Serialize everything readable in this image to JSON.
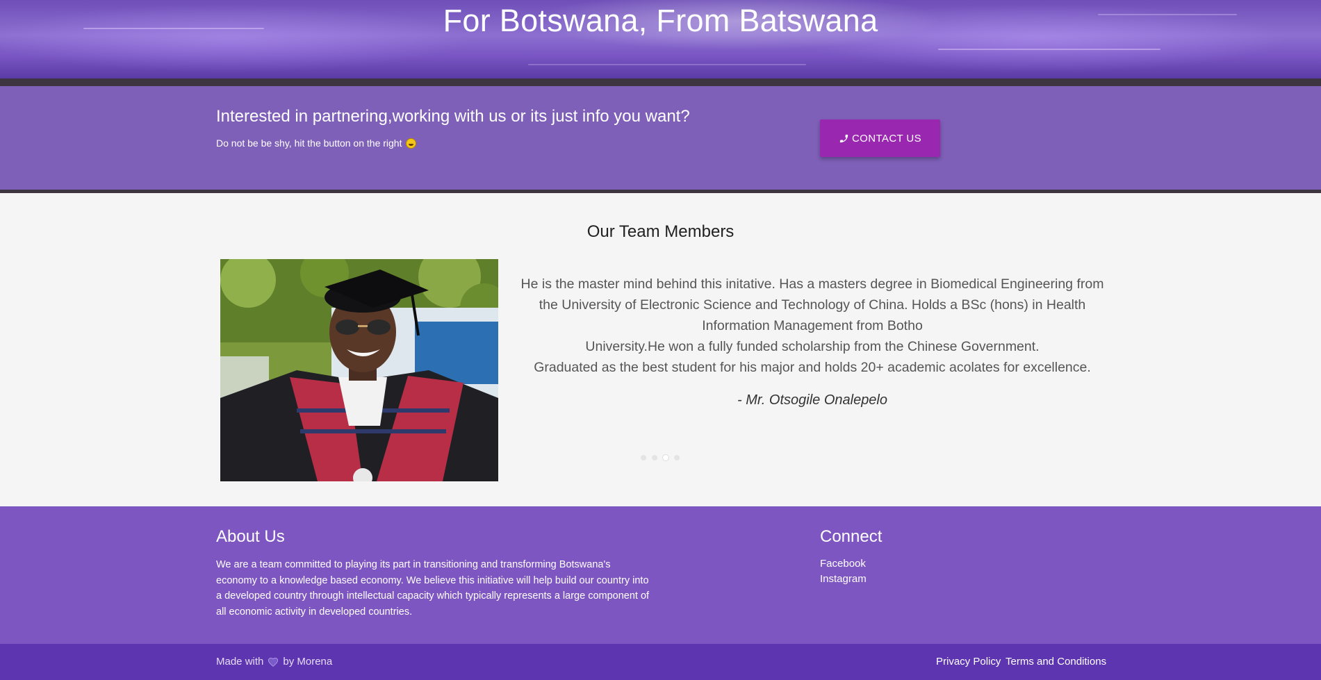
{
  "banner": {
    "title": "For Botswana, From Batswana"
  },
  "cta": {
    "heading": "Interested in partnering,working with us or its just info you want?",
    "subtext": "Do not be be shy, hit the button on the right",
    "button_label": "CONTACT US",
    "button_icon": "phone-icon",
    "button_color": "#9a27b0"
  },
  "team": {
    "title": "Our Team Members",
    "bio_lines": [
      "He is the master mind behind this initative. Has a masters degree in Biomedical Engineering from",
      "the University of Electronic Science and Technology of China. Holds a BSc (hons) in Health",
      "Information Management from Botho",
      "University.He won a fully funded scholarship from the Chinese Government.",
      "Graduated as the best student for his major and holds 20+ academic acolates for excellence."
    ],
    "author": "- Mr. Otsogile Onalepelo",
    "carousel_dots": 4,
    "active_dot": 3
  },
  "footer": {
    "about_title": "About Us",
    "about_text": "We are a team committed to playing its part in transitioning and transforming Botswana's economy to a knowledge based economy. We believe this initiative will help build our country into a developed country through intellectual capacity which typically represents a large component of all economic activity in developed countries.",
    "connect_title": "Connect",
    "connect_links": [
      "Facebook",
      "Instagram"
    ]
  },
  "bottom_bar": {
    "made_with_prefix": "Made with",
    "made_with_suffix": "by Morena",
    "links": [
      "Privacy Policy",
      "Terms and Conditions"
    ]
  },
  "colors": {
    "cta_background": "#7e60b8",
    "footer_background": "#7e56c1",
    "bottom_bar_background": "#5e35b1"
  }
}
